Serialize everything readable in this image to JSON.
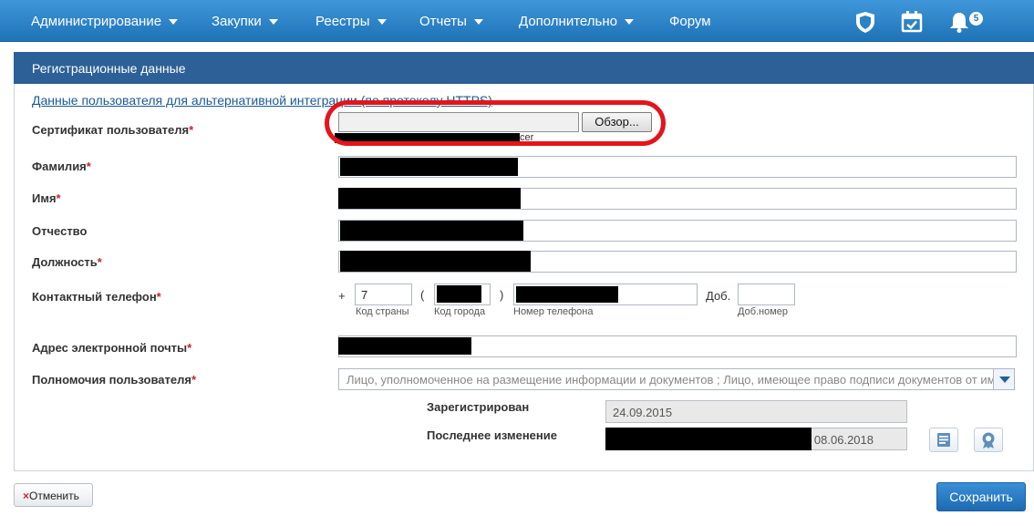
{
  "nav": {
    "items": [
      {
        "label": "Администрирование",
        "has_dropdown": true
      },
      {
        "label": "Закупки",
        "has_dropdown": true
      },
      {
        "label": "Реестры",
        "has_dropdown": true
      },
      {
        "label": "Отчеты",
        "has_dropdown": true
      },
      {
        "label": "Дополнительно",
        "has_dropdown": true
      },
      {
        "label": "Форум",
        "has_dropdown": false
      }
    ],
    "icons": [
      "shield-icon",
      "calendar-check-icon",
      "bell-icon"
    ],
    "notification_count": "5"
  },
  "panel": {
    "title": "Регистрационные данные",
    "alt_integration_link": "Данные пользователя для альтернативной интеграции (по протоколу HTTPS)"
  },
  "form": {
    "certificate": {
      "label": "Сертификат пользователя",
      "browse_label": "Обзор...",
      "file_name_suffix": "cer"
    },
    "last_name": {
      "label": "Фамилия"
    },
    "first_name": {
      "label": "Имя"
    },
    "patronymic": {
      "label": "Отчество"
    },
    "position": {
      "label": "Должность"
    },
    "phone": {
      "label": "Контактный телефон",
      "plus": "+",
      "country_code": "7",
      "country_caption": "Код страны",
      "open_paren": "(",
      "close_paren": ")",
      "city_caption": "Код города",
      "number_caption": "Номер телефона",
      "ext_label": "Доб.",
      "ext_caption": "Доб.номер"
    },
    "email": {
      "label": "Адрес электронной почты"
    },
    "authority": {
      "label": "Полномочия пользователя",
      "value": "Лицо, уполномоченное на размещение информации и документов ; Лицо, имеющее право подписи документов от имени"
    },
    "required_mark": "*",
    "registered": {
      "label": "Зарегистрирован",
      "value": "24.09.2015"
    },
    "last_modified": {
      "label": "Последнее изменение",
      "value": "08.06.2018"
    }
  },
  "footer": {
    "cancel_icon": "×",
    "cancel_label": "Отменить",
    "save_label": "Сохранить"
  },
  "colors": {
    "nav_bg": "#2a82c7",
    "panel_header": "#2d6096",
    "required": "#c0282e",
    "highlight": "#e3151b",
    "link": "#1a5a98"
  }
}
